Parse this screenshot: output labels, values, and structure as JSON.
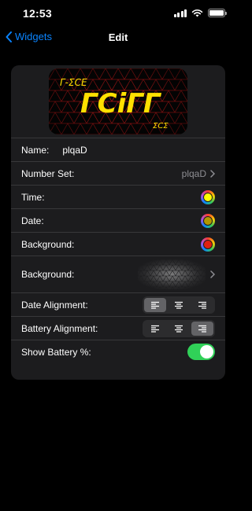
{
  "status_bar": {
    "time": "12:53",
    "icons": [
      "cellular-signal-icon",
      "wifi-icon",
      "battery-icon"
    ]
  },
  "nav": {
    "back_label": "Widgets",
    "title": "Edit"
  },
  "preview": {
    "image": "clock-widget-preview",
    "top_text": "Γ-ΣCΕ",
    "main_text": "ΓCiΓΓ",
    "bottom_text": "ΣCΣ",
    "text_color": "#ffe000",
    "grid_color": "#b81818"
  },
  "settings": {
    "name": {
      "label": "Name:",
      "value": "plqaD"
    },
    "number_set": {
      "label": "Number Set:",
      "value": "plqaD"
    },
    "time": {
      "label": "Time:",
      "color": "#ffff00"
    },
    "date": {
      "label": "Date:",
      "color": "#b29800"
    },
    "background_color": {
      "label": "Background:",
      "color": "#e02010"
    },
    "background_image": {
      "label": "Background:",
      "image": "triangular-mesh-pattern"
    },
    "date_alignment": {
      "label": "Date Alignment:",
      "options": [
        "align-left-icon",
        "align-center-icon",
        "align-right-icon"
      ],
      "selected": "left"
    },
    "battery_alignment": {
      "label": "Battery Alignment:",
      "options": [
        "align-left-icon",
        "align-center-icon",
        "align-right-icon"
      ],
      "selected": "right"
    },
    "show_battery": {
      "label": "Show Battery %:",
      "enabled": true
    }
  },
  "colors": {
    "accent": "#0a84ff",
    "toggle_on": "#30d158",
    "card_bg": "#1c1c1e"
  }
}
